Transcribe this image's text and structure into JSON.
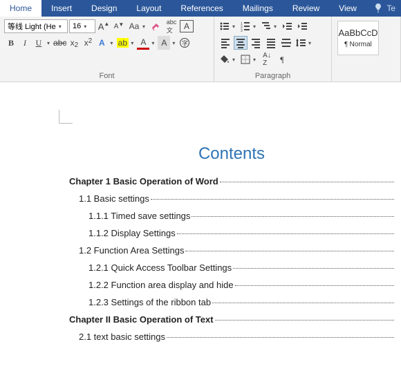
{
  "tabs": {
    "items": [
      "Home",
      "Insert",
      "Design",
      "Layout",
      "References",
      "Mailings",
      "Review",
      "View"
    ],
    "active": 0,
    "tellme": "Te"
  },
  "font_group": {
    "label": "Font",
    "font_name": "等线 Light (He",
    "font_size": "16"
  },
  "para_group": {
    "label": "Paragraph"
  },
  "styles": {
    "preview": "AaBbCcD",
    "name": "Normal"
  },
  "doc": {
    "title": "Contents",
    "toc": [
      {
        "level": 1,
        "text": "Chapter 1 Basic Operation of Word"
      },
      {
        "level": 2,
        "text": "1.1 Basic settings"
      },
      {
        "level": 3,
        "text": "1.1.1 Timed save settings"
      },
      {
        "level": 3,
        "text": "1.1.2 Display Settings"
      },
      {
        "level": 2,
        "text": "1.2 Function Area Settings"
      },
      {
        "level": 3,
        "text": "1.2.1 Quick Access Toolbar Settings"
      },
      {
        "level": 3,
        "text": "1.2.2 Function area display and hide"
      },
      {
        "level": 3,
        "text": "1.2.3 Settings of the ribbon tab"
      },
      {
        "level": 1,
        "text": "Chapter II Basic Operation of Text"
      },
      {
        "level": 2,
        "text": "2.1 text basic settings"
      }
    ]
  }
}
